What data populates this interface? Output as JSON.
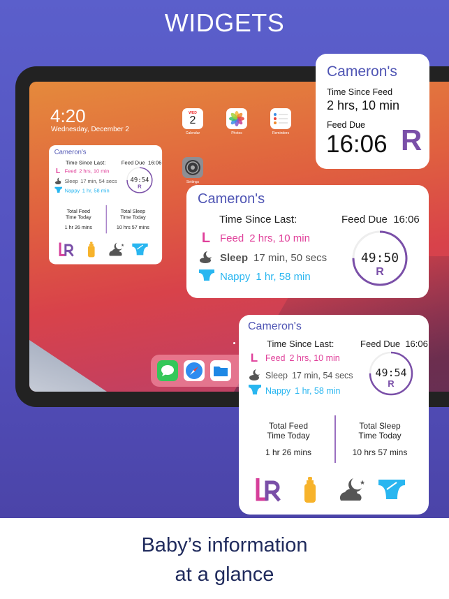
{
  "hero_title": "WIDGETS",
  "tagline": [
    "Baby’s information",
    "at a glance"
  ],
  "colors": {
    "accent": "#4f55b4",
    "feed": "#e0409a",
    "sleep": "#555555",
    "nappy": "#29b6f0",
    "side": "#7a4fa8"
  },
  "lock": {
    "time": "4:20",
    "date": "Wednesday, December 2"
  },
  "apps": [
    {
      "label": "Calendar",
      "day": "WED",
      "date": "2"
    },
    {
      "label": "Photos"
    },
    {
      "label": "Reminders"
    },
    {
      "label": "Settings"
    }
  ],
  "dock": [
    "messages-icon",
    "safari-icon",
    "files-icon"
  ],
  "widget": {
    "name": "Cameron's",
    "time_since_label": "Time Since Last:",
    "feed_due_label": "Feed Due",
    "feed_due_time": "16:06",
    "feed_side_icon": "L",
    "feed": {
      "label": "Feed",
      "value": "2 hrs, 10 min"
    },
    "sleep": {
      "label": "Sleep",
      "value": "17 min, 54 secs"
    },
    "nappy": {
      "label": "Nappy",
      "value": "1 hr, 58 min"
    },
    "countdown": "49:54",
    "next_side": "R",
    "countdown_progress": 0.75,
    "total_feed_label": [
      "Total Feed",
      "Time Today"
    ],
    "total_feed_value": "1 hr 26 mins",
    "total_sleep_label": [
      "Total Sleep",
      "Time Today"
    ],
    "total_sleep_value": "10 hrs 57 mins"
  },
  "medium_widget": {
    "name": "Cameron's",
    "time_since_label": "Time Since Last:",
    "feed_due_label": "Feed Due",
    "feed_due_time": "16:06",
    "feed_side_icon": "L",
    "feed": {
      "label": "Feed",
      "value": "2 hrs, 10 min"
    },
    "sleep": {
      "label": "Sleep",
      "value": "17 min, 50 secs"
    },
    "nappy": {
      "label": "Nappy",
      "value": "1 hr, 58 min"
    },
    "countdown": "49:50",
    "next_side": "R"
  },
  "feed_widget": {
    "name": "Cameron's",
    "since_label": "Time Since Feed",
    "since_value": "2 hrs, 10 min",
    "due_label": "Feed Due",
    "due_value": "16:06",
    "next_side": "R"
  }
}
